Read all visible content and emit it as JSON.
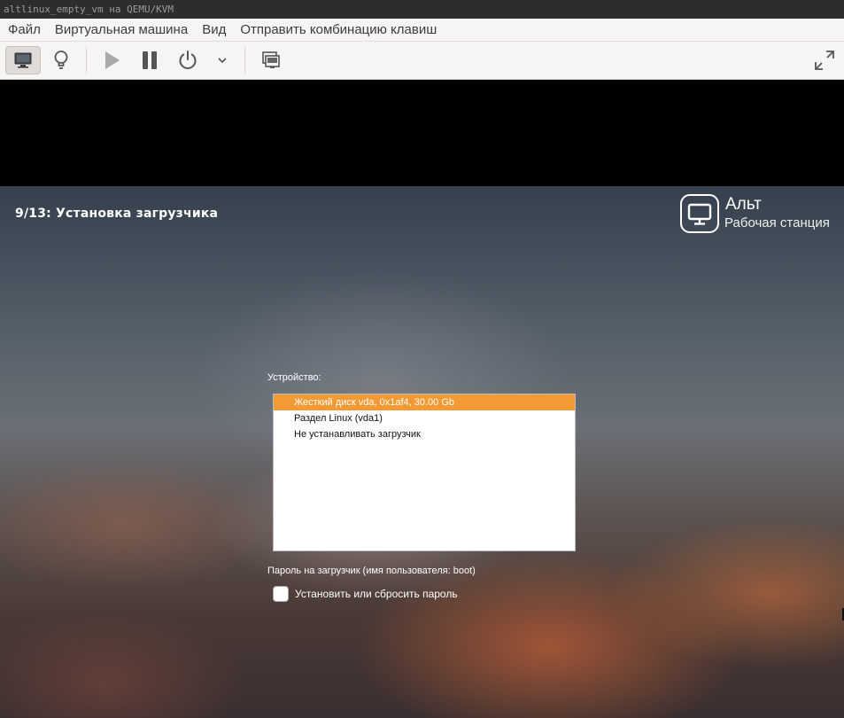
{
  "window": {
    "title": "altlinux_empty_vm на QEMU/KVM"
  },
  "menubar": {
    "items": [
      "Файл",
      "Виртуальная машина",
      "Вид",
      "Отправить комбинацию клавиш"
    ]
  },
  "toolbar": {
    "buttons": [
      {
        "icon": "monitor-icon",
        "active": true
      },
      {
        "icon": "lightbulb-icon"
      },
      {
        "icon": "play-icon"
      },
      {
        "icon": "pause-icon"
      },
      {
        "icon": "power-icon"
      },
      {
        "icon": "chevron-down-icon"
      },
      {
        "icon": "snapshots-icon"
      },
      {
        "icon": "fullscreen-icon"
      }
    ]
  },
  "installer": {
    "step_title": "9/13: Установка загрузчика",
    "logo": {
      "name": "Альт",
      "subtitle": "Рабочая станция"
    },
    "device_label": "Устройство:",
    "devices": [
      "Жесткий диск vda, 0x1af4, 30.00 Gb",
      "Раздел Linux (vda1)",
      "Не устанавливать загрузчик"
    ],
    "selected_device": "Жесткий диск vda, 0x1af4, 30.00 Gb",
    "password_label": "Пароль на загрузчик (имя пользователя: boot)",
    "password_checkbox_label": "Установить или сбросить пароль",
    "password_checkbox_checked": false
  },
  "colors": {
    "selection": "#f39a34",
    "toolbar_bg": "#f6f5f4",
    "titlebar_bg": "#2d2d2d"
  }
}
